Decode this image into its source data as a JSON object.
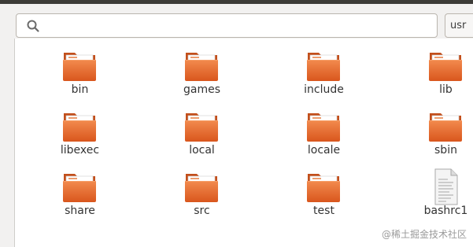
{
  "location": {
    "current": "usr"
  },
  "search": {
    "value": "",
    "placeholder": ""
  },
  "folder_color": "#e96b2a",
  "items": [
    {
      "name": "bin",
      "type": "folder"
    },
    {
      "name": "games",
      "type": "folder"
    },
    {
      "name": "include",
      "type": "folder"
    },
    {
      "name": "lib",
      "type": "folder"
    },
    {
      "name": "libexec",
      "type": "folder"
    },
    {
      "name": "local",
      "type": "folder"
    },
    {
      "name": "locale",
      "type": "folder"
    },
    {
      "name": "sbin",
      "type": "folder"
    },
    {
      "name": "share",
      "type": "folder"
    },
    {
      "name": "src",
      "type": "folder"
    },
    {
      "name": "test",
      "type": "folder"
    },
    {
      "name": "bashrc1",
      "type": "text-file"
    }
  ],
  "watermark": "@稀土掘金技术社区"
}
